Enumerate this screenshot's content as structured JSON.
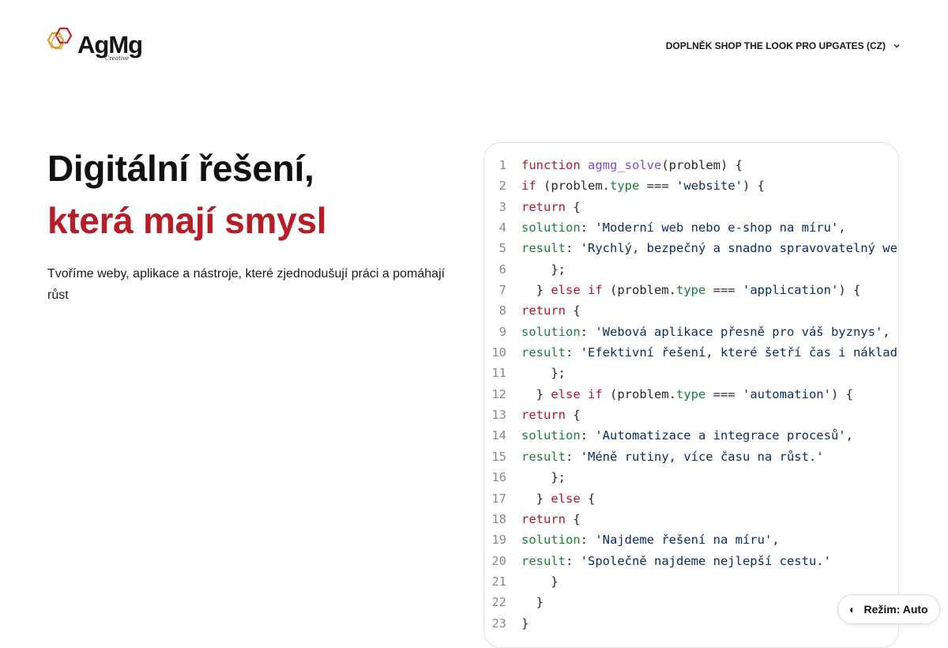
{
  "header": {
    "logo_text": "AgMg",
    "logo_sub": "Creative",
    "nav_label": "DOPLNĚK SHOP THE LOOK PRO UPGATES (CZ)"
  },
  "hero": {
    "title_line1": "Digitální řešení,",
    "title_line2": "která mají smysl",
    "lead": "Tvoříme weby, aplikace a nástroje, které zjednodušují práci a pomáhají růst"
  },
  "code_lines": [
    {
      "n": "1",
      "tokens": [
        [
          "kw",
          "function "
        ],
        [
          "fn",
          "agmg_solve"
        ],
        [
          "plain",
          "(problem) {"
        ]
      ]
    },
    {
      "n": "2",
      "tokens": [
        [
          "kw",
          "if"
        ],
        [
          "plain",
          " (problem."
        ],
        [
          "prop",
          "type"
        ],
        [
          "plain",
          " === "
        ],
        [
          "str",
          "'website'"
        ],
        [
          "plain",
          ") {"
        ]
      ]
    },
    {
      "n": "3",
      "tokens": [
        [
          "kw",
          "return"
        ],
        [
          "plain",
          " {"
        ]
      ]
    },
    {
      "n": "4",
      "tokens": [
        [
          "prop",
          "solution"
        ],
        [
          "plain",
          ": "
        ],
        [
          "str",
          "'Moderní web nebo e-shop na míru'"
        ],
        [
          "plain",
          ","
        ]
      ]
    },
    {
      "n": "5",
      "tokens": [
        [
          "prop",
          "result"
        ],
        [
          "plain",
          ": "
        ],
        [
          "str",
          "'Rychlý, bezpečný a snadno spravovatelný web'"
        ],
        [
          "plain",
          ""
        ]
      ]
    },
    {
      "n": "6",
      "tokens": [
        [
          "plain",
          "    };"
        ]
      ]
    },
    {
      "n": "7",
      "tokens": [
        [
          "plain",
          "  } "
        ],
        [
          "kw",
          "else if"
        ],
        [
          "plain",
          " (problem."
        ],
        [
          "prop",
          "type"
        ],
        [
          "plain",
          " === "
        ],
        [
          "str",
          "'application'"
        ],
        [
          "plain",
          ") {"
        ]
      ]
    },
    {
      "n": "8",
      "tokens": [
        [
          "kw",
          "return"
        ],
        [
          "plain",
          " {"
        ]
      ]
    },
    {
      "n": "9",
      "tokens": [
        [
          "prop",
          "solution"
        ],
        [
          "plain",
          ": "
        ],
        [
          "str",
          "'Webová aplikace přesně pro váš byznys'"
        ],
        [
          "plain",
          ","
        ]
      ]
    },
    {
      "n": "10",
      "tokens": [
        [
          "prop",
          "result"
        ],
        [
          "plain",
          ": "
        ],
        [
          "str",
          "'Efektivní řešení, které šetří čas i náklady'"
        ],
        [
          "plain",
          ""
        ]
      ]
    },
    {
      "n": "11",
      "tokens": [
        [
          "plain",
          "    };"
        ]
      ]
    },
    {
      "n": "12",
      "tokens": [
        [
          "plain",
          "  } "
        ],
        [
          "kw",
          "else if"
        ],
        [
          "plain",
          " (problem."
        ],
        [
          "prop",
          "type"
        ],
        [
          "plain",
          " === "
        ],
        [
          "str",
          "'automation'"
        ],
        [
          "plain",
          ") {"
        ]
      ]
    },
    {
      "n": "13",
      "tokens": [
        [
          "kw",
          "return"
        ],
        [
          "plain",
          " {"
        ]
      ]
    },
    {
      "n": "14",
      "tokens": [
        [
          "prop",
          "solution"
        ],
        [
          "plain",
          ": "
        ],
        [
          "str",
          "'Automatizace a integrace procesů'"
        ],
        [
          "plain",
          ","
        ]
      ]
    },
    {
      "n": "15",
      "tokens": [
        [
          "prop",
          "result"
        ],
        [
          "plain",
          ": "
        ],
        [
          "str",
          "'Méně rutiny, více času na růst.'"
        ]
      ]
    },
    {
      "n": "16",
      "tokens": [
        [
          "plain",
          "    };"
        ]
      ]
    },
    {
      "n": "17",
      "tokens": [
        [
          "plain",
          "  } "
        ],
        [
          "kw",
          "else"
        ],
        [
          "plain",
          " {"
        ]
      ]
    },
    {
      "n": "18",
      "tokens": [
        [
          "kw",
          "return"
        ],
        [
          "plain",
          " {"
        ]
      ]
    },
    {
      "n": "19",
      "tokens": [
        [
          "prop",
          "solution"
        ],
        [
          "plain",
          ": "
        ],
        [
          "str",
          "'Najdeme řešení na míru'"
        ],
        [
          "plain",
          ","
        ]
      ]
    },
    {
      "n": "20",
      "tokens": [
        [
          "prop",
          "result"
        ],
        [
          "plain",
          ": "
        ],
        [
          "str",
          "'Společně najdeme nejlepší cestu.'"
        ]
      ]
    },
    {
      "n": "21",
      "tokens": [
        [
          "plain",
          "    }"
        ]
      ]
    },
    {
      "n": "22",
      "tokens": [
        [
          "plain",
          "  }"
        ]
      ]
    },
    {
      "n": "23",
      "tokens": [
        [
          "plain",
          "}"
        ]
      ]
    }
  ],
  "mode_toggle": {
    "icon": "◐",
    "label": "Režim: Auto"
  },
  "colors": {
    "accent_red": "#b71c27",
    "keyword": "#b4162b",
    "function": "#7c4dd8",
    "property": "#1a7f37",
    "string": "#0b2f63"
  }
}
